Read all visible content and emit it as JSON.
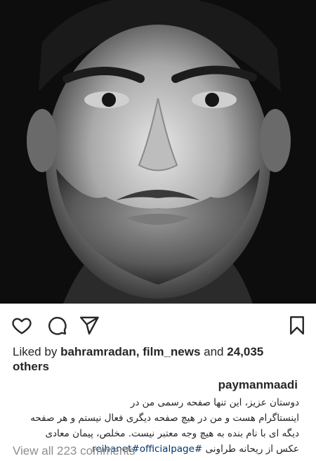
{
  "post": {
    "image": {
      "subject": "black-and-white close-up portrait",
      "palette": [
        "#0b0b0b",
        "#6e6e6e",
        "#d9d9d9"
      ]
    },
    "icons": {
      "like": "heart-icon",
      "comment": "comment-bubble-icon",
      "share": "paper-plane-icon",
      "save": "bookmark-icon"
    },
    "likes": {
      "prefix": "Liked by",
      "users": "bahramradan, film_news",
      "connector": "and",
      "count": "24,035",
      "suffix": "others"
    },
    "caption": {
      "username": "paymanmaadi",
      "line1": "دوستان عزیز، این تنها صفحه رسمی من در",
      "line2": "اینستاگرام هست و من در هیچ صفحه دیگری فعال نیستم و هر صفحه",
      "line3": "دیگه ای با نام بنده به هیچ وجه معتبر نیست. مخلص، پیمان معادی",
      "line4_text": "عکس از ریحانه طراونی",
      "line4_tags": "reihanet#officialpage#"
    },
    "comments": {
      "view_all": "View all 223 comments"
    },
    "colors": {
      "text": "#262626",
      "muted": "#8e8e8e",
      "hashtag": "#003569"
    }
  }
}
